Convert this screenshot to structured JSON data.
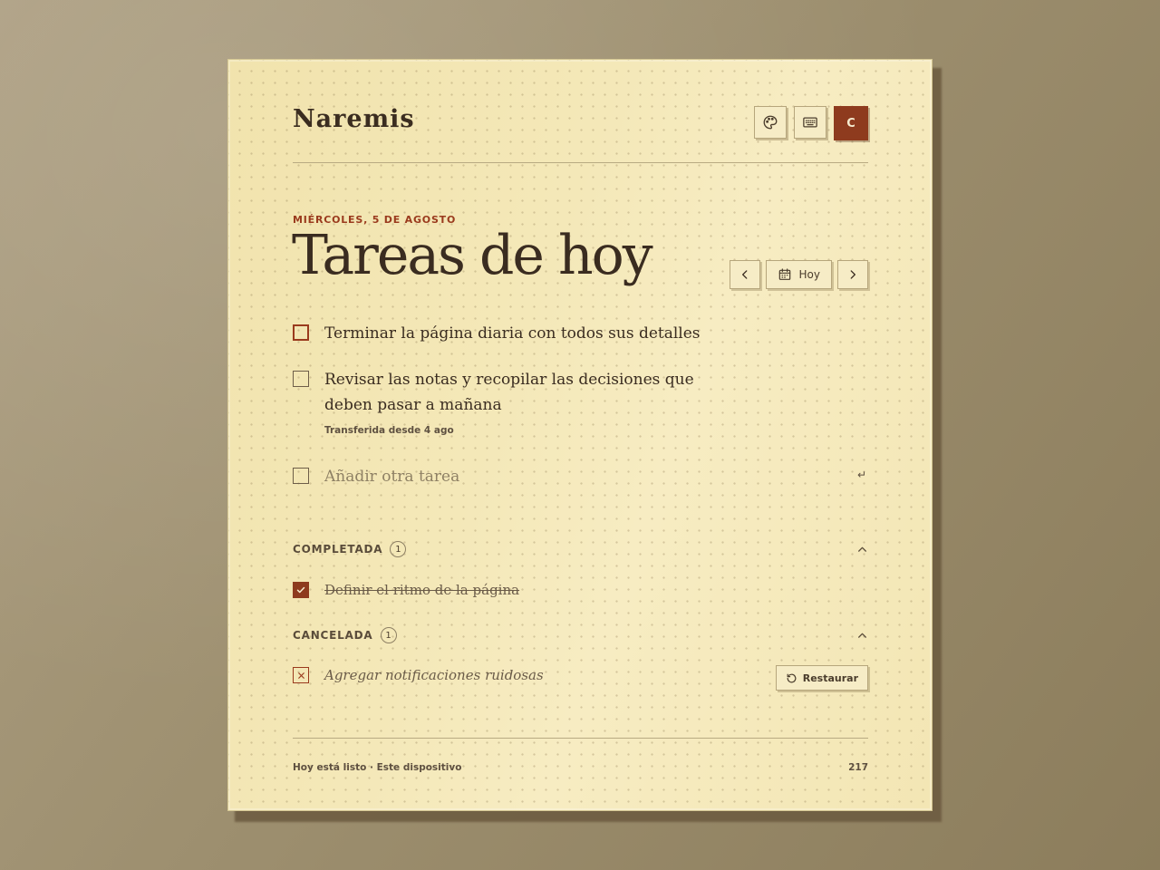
{
  "app": {
    "brand": "Naremis",
    "avatar_initial": "C"
  },
  "header": {
    "actions": [
      {
        "name": "theme",
        "icon": "palette-icon"
      },
      {
        "name": "shortcuts",
        "icon": "keyboard-icon"
      }
    ]
  },
  "date": {
    "label": "MIÉRCOLES, 5 DE AGOSTO",
    "today_button": "Hoy"
  },
  "title": "Tareas de hoy",
  "tasks": [
    {
      "text": "Terminar la página diaria con todos sus detalles",
      "focused": true
    },
    {
      "text": "Revisar las notas y recopilar las decisiones que deben pasar a mañana",
      "meta": "Transferida desde 4 ago"
    }
  ],
  "add_task": {
    "placeholder": "Añadir otra tarea",
    "enter_hint": "↵"
  },
  "sections": {
    "completed": {
      "title": "COMPLETADA",
      "count": "1",
      "items": [
        {
          "text": "Definir el ritmo de la página"
        }
      ]
    },
    "cancelled": {
      "title": "CANCELADA",
      "count": "1",
      "items": [
        {
          "text": "Agregar notificaciones ruidosas",
          "action": "Restaurar"
        }
      ]
    }
  },
  "footer": {
    "status": "Hoy está listo · Este dispositivo",
    "count": "217"
  },
  "colors": {
    "accent": "#8e3b1e",
    "paper": "#f3e6b3",
    "ink": "#3a2c20"
  }
}
